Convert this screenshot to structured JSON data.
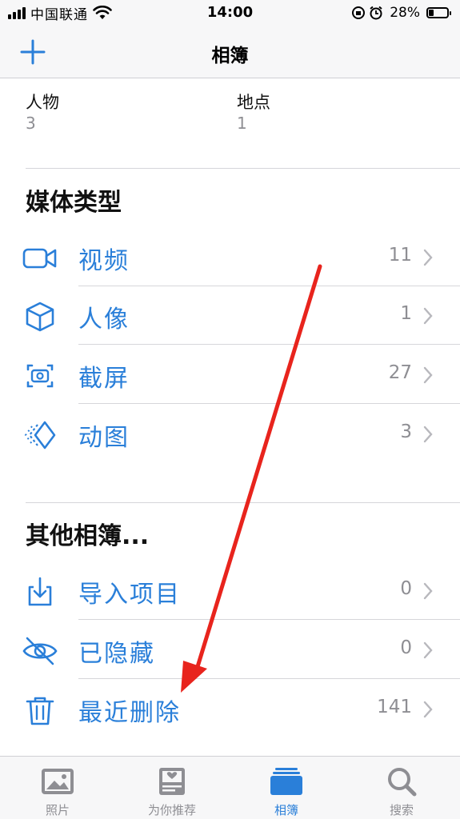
{
  "status_bar": {
    "carrier": "中国联通",
    "time": "14:00",
    "battery": "28%",
    "battery_level": 0.28
  },
  "nav": {
    "title": "相簿",
    "add_icon": "plus-icon"
  },
  "people_places": [
    {
      "label": "人物",
      "count": "3"
    },
    {
      "label": "地点",
      "count": "1"
    }
  ],
  "media_types": {
    "title": "媒体类型",
    "items": [
      {
        "label": "视频",
        "count": "11",
        "icon": "video-icon"
      },
      {
        "label": "人像",
        "count": "1",
        "icon": "cube-icon"
      },
      {
        "label": "截屏",
        "count": "27",
        "icon": "screenshot-icon"
      },
      {
        "label": "动图",
        "count": "3",
        "icon": "animated-icon"
      }
    ]
  },
  "other_albums": {
    "title": "其他相簿...",
    "items": [
      {
        "label": "导入项目",
        "count": "0",
        "icon": "import-icon"
      },
      {
        "label": "已隐藏",
        "count": "0",
        "icon": "hidden-eye-icon"
      },
      {
        "label": "最近删除",
        "count": "141",
        "icon": "trash-icon"
      }
    ]
  },
  "tabs": [
    {
      "label": "照片",
      "icon": "photos-icon",
      "active": false
    },
    {
      "label": "为你推荐",
      "icon": "for-you-icon",
      "active": false
    },
    {
      "label": "相簿",
      "icon": "albums-icon",
      "active": true
    },
    {
      "label": "搜索",
      "icon": "search-icon",
      "active": false
    }
  ],
  "colors": {
    "accent": "#2a7fd9",
    "annotation_arrow": "#e8241d",
    "secondary_text": "#8e8e93"
  }
}
